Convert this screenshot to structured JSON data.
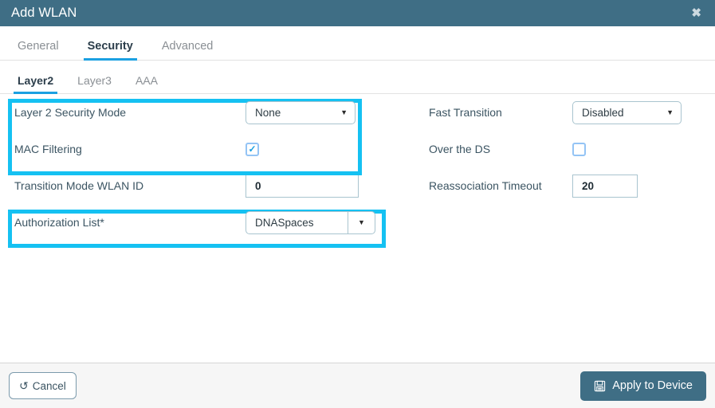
{
  "window": {
    "title": "Add WLAN",
    "close_icon": "close-icon",
    "close_glyph": "✖"
  },
  "tabs_primary": [
    {
      "label": "General",
      "active": false
    },
    {
      "label": "Security",
      "active": true
    },
    {
      "label": "Advanced",
      "active": false
    }
  ],
  "tabs_secondary": [
    {
      "label": "Layer2",
      "active": true
    },
    {
      "label": "Layer3",
      "active": false
    },
    {
      "label": "AAA",
      "active": false
    }
  ],
  "form": {
    "left": {
      "layer2_security_mode": {
        "label": "Layer 2 Security Mode",
        "value": "None",
        "caret": "▼"
      },
      "mac_filtering": {
        "label": "MAC Filtering",
        "checked": true,
        "tick": "✓"
      },
      "transition_mode_wlan_id": {
        "label": "Transition Mode WLAN ID",
        "value": "0"
      },
      "authorization_list": {
        "label": "Authorization List*",
        "value": "DNASpaces",
        "caret": "▼"
      }
    },
    "right": {
      "fast_transition": {
        "label": "Fast Transition",
        "value": "Disabled",
        "caret": "▼"
      },
      "over_the_ds": {
        "label": "Over the DS",
        "checked": false
      },
      "reassociation_timeout": {
        "label": "Reassociation Timeout",
        "value": "20"
      }
    }
  },
  "footer": {
    "cancel_label": "Cancel",
    "cancel_icon": "undo-icon",
    "cancel_glyph": "↺",
    "apply_label": "Apply to Device",
    "apply_icon": "save-floppy-icon"
  },
  "colors": {
    "header_bg": "#3f6e85",
    "accent_blue": "#1ba0e1",
    "highlight_cyan": "#15c1f2",
    "label_text": "#3b5462",
    "footer_bg": "#f6f6f6",
    "checkbox_border": "#94c4f5"
  }
}
